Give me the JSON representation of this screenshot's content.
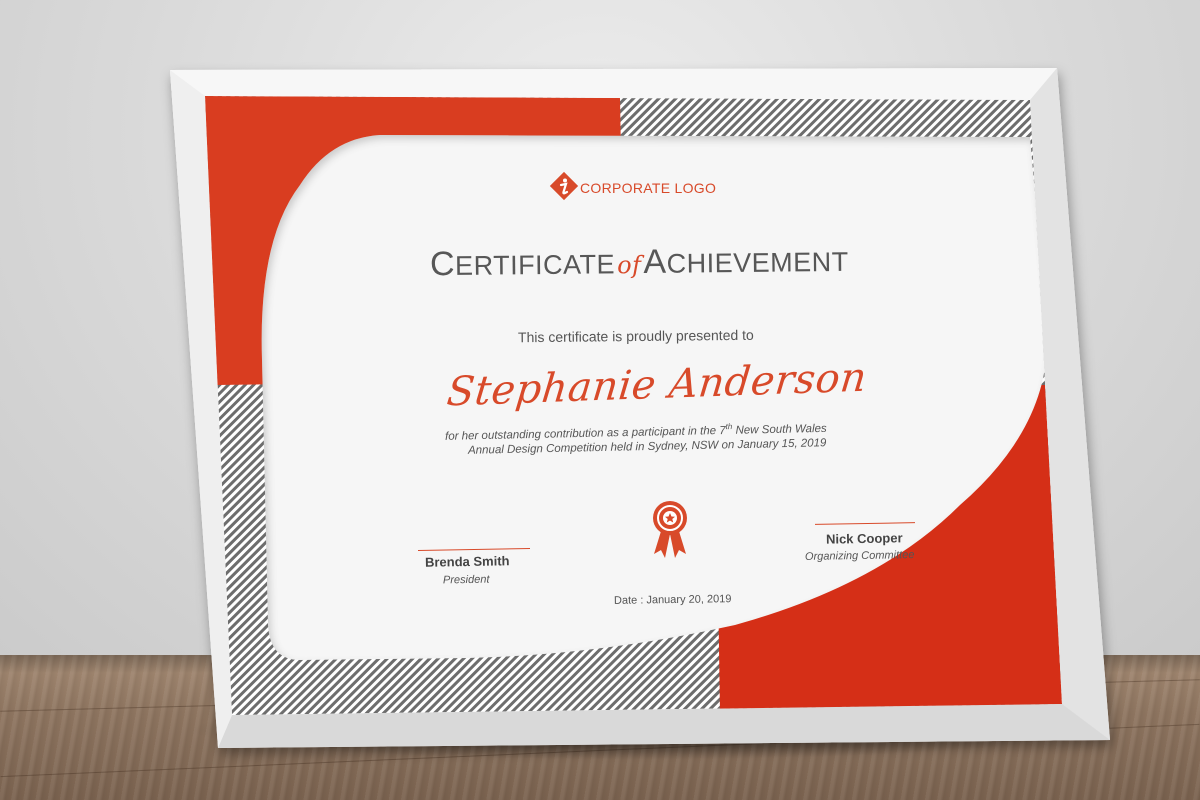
{
  "logo": {
    "text": "CORPORATE LOGO",
    "icon": "diamond-i-logo-icon"
  },
  "title": {
    "c": "C",
    "ertificate": "ERTIFICATE",
    "of": "of",
    "a": "A",
    "chievement": "CHIEVEMENT"
  },
  "presented_text": "This certificate is proudly presented to",
  "recipient": "Stephanie Anderson",
  "description": {
    "line1_a": "for her outstanding contribution as a participant in the 7",
    "line1_sup": "th",
    "line1_b": " New South Wales",
    "line2": "Annual Design Competition held in Sydney, NSW on January 15, 2019"
  },
  "signatories": [
    {
      "name": "Brenda Smith",
      "role": "President"
    },
    {
      "name": "Nick Cooper",
      "role": "Organizing Committee"
    }
  ],
  "date": "Date : January 20, 2019",
  "badge": {
    "icon": "award-ribbon-icon"
  },
  "colors": {
    "accent": "#d84a2a",
    "text": "#555555",
    "frame": "#f4f4f4"
  }
}
